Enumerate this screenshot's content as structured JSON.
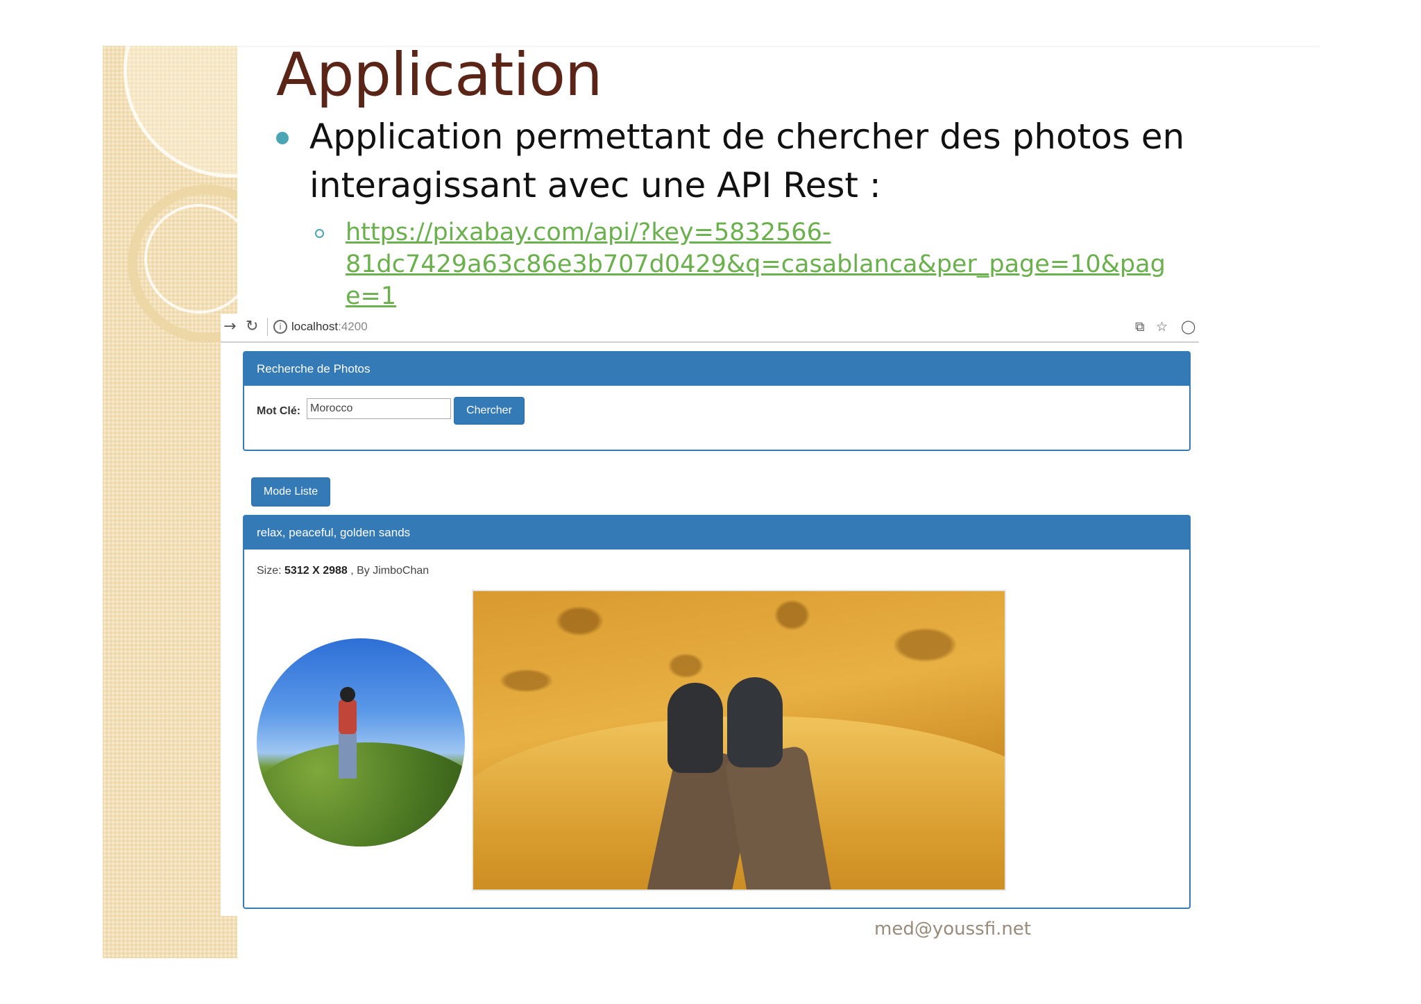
{
  "slide": {
    "title": "Application",
    "bullet": "Application permettant de chercher des photos en interagissant avec une API Rest :",
    "link_line1": "https://pixabay.com/api/?key=5832566-",
    "link_line2": "81dc7429a63c86e3b707d0429&q=casablanca&per_page=10&page=1",
    "footer": "med@youssfi.net"
  },
  "browser": {
    "url_host": "localhost",
    "url_port": ":4200",
    "icons": [
      "back-arrow-icon",
      "reload-icon",
      "info-icon",
      "translate-icon",
      "star-icon",
      "extension-icon"
    ]
  },
  "search_panel": {
    "heading": "Recherche de Photos",
    "label": "Mot Clé:",
    "keyword_value": "Morocco",
    "button": "Chercher"
  },
  "mode_button": "Mode Liste",
  "photo_panel": {
    "heading": "relax, peaceful, golden sands",
    "size_label": "Size:",
    "size_value": "5312 X 2988",
    "by_text": ", By JimboChan"
  },
  "colors": {
    "primary": "#337ab7",
    "title": "#5a2417",
    "link": "#6ab04c",
    "bullet": "#4aa6b5"
  }
}
